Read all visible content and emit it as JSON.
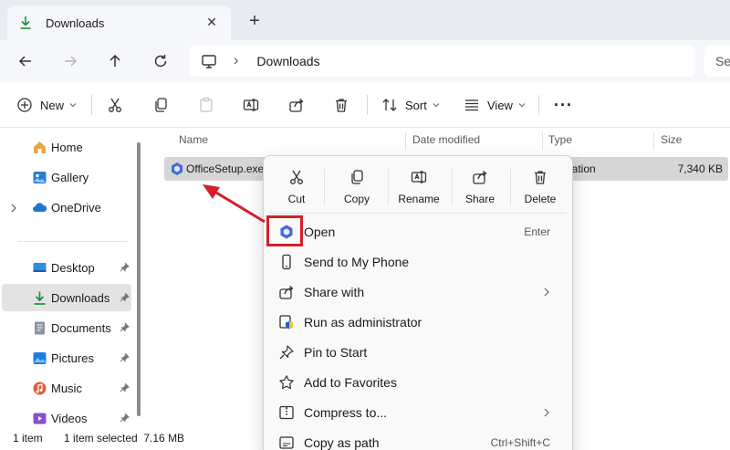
{
  "tab": {
    "title": "Downloads",
    "close_symbol": "✕",
    "add_symbol": "+"
  },
  "address": {
    "separator": "›",
    "crumb": "Downloads"
  },
  "search": {
    "placeholder": "Se"
  },
  "toolbar": {
    "new_label": "New",
    "sort_label": "Sort",
    "view_label": "View",
    "more_label": "···"
  },
  "sidebar": {
    "items": [
      {
        "label": "Home",
        "icon": "home-icon"
      },
      {
        "label": "Gallery",
        "icon": "gallery-icon"
      },
      {
        "label": "OneDrive",
        "icon": "onedrive-icon"
      },
      {
        "label": "Desktop",
        "icon": "desktop-folder-icon"
      },
      {
        "label": "Downloads",
        "icon": "downloads-icon"
      },
      {
        "label": "Documents",
        "icon": "documents-icon"
      },
      {
        "label": "Pictures",
        "icon": "pictures-icon"
      },
      {
        "label": "Music",
        "icon": "music-icon"
      },
      {
        "label": "Videos",
        "icon": "videos-icon"
      }
    ]
  },
  "columns": {
    "name": "Name",
    "date": "Date modified",
    "type": "Type",
    "size": "Size"
  },
  "file": {
    "name": "OfficeSetup.exe",
    "type": "ication",
    "size": "7,340 KB"
  },
  "status": {
    "count": "1 item",
    "selected": "1 item selected  7.16 MB"
  },
  "context_menu": {
    "quick_actions": [
      {
        "label": "Cut",
        "icon": "cut-icon"
      },
      {
        "label": "Copy",
        "icon": "copy-icon"
      },
      {
        "label": "Rename",
        "icon": "rename-icon"
      },
      {
        "label": "Share",
        "icon": "share-icon"
      },
      {
        "label": "Delete",
        "icon": "delete-icon"
      }
    ],
    "items": [
      {
        "label": "Open",
        "shortcut": "Enter",
        "icon": "office-logo-icon"
      },
      {
        "label": "Send to My Phone",
        "icon": "phone-icon"
      },
      {
        "label": "Share with",
        "icon": "share-with-icon"
      },
      {
        "label": "Run as administrator",
        "icon": "admin-shield-icon"
      },
      {
        "label": "Pin to Start",
        "icon": "pin-icon"
      },
      {
        "label": "Add to Favorites",
        "icon": "star-icon"
      },
      {
        "label": "Compress to...",
        "icon": "compress-icon"
      },
      {
        "label": "Copy as path",
        "shortcut": "Ctrl+Shift+C",
        "icon": "copy-path-icon"
      }
    ]
  },
  "colors": {
    "accent": "#0067c0",
    "annotation": "#d32027",
    "selection": "#d6d6d6"
  }
}
